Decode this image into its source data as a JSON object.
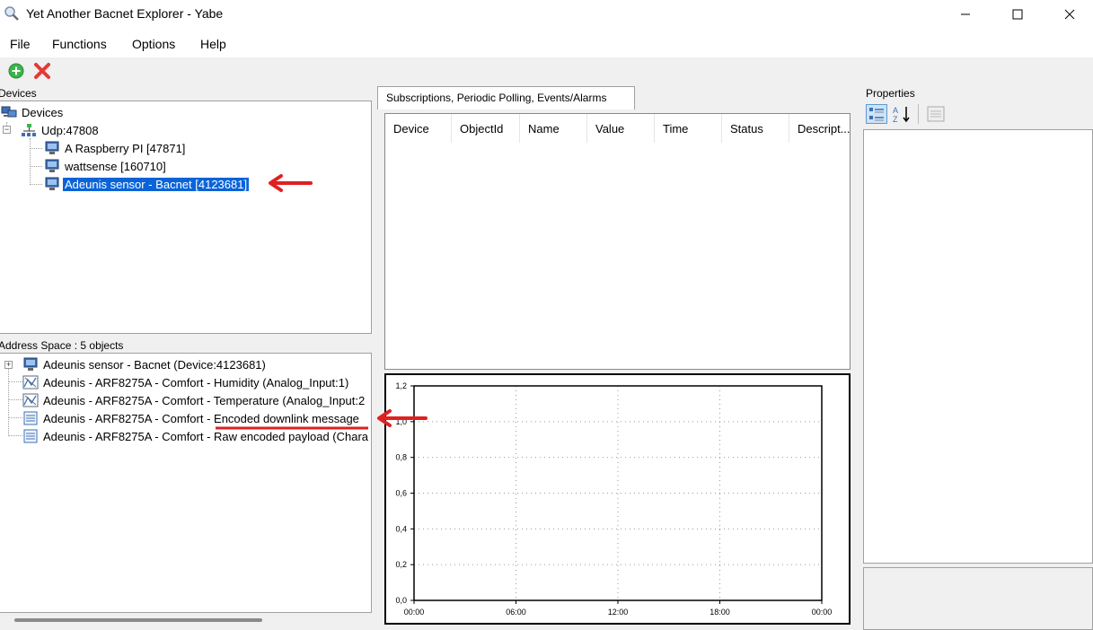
{
  "window": {
    "title": "Yet Another Bacnet Explorer - Yabe"
  },
  "menu": [
    "File",
    "Functions",
    "Options",
    "Help"
  ],
  "devices_panel": {
    "label": "Devices",
    "root": "Devices",
    "network": "Udp:47808",
    "items": [
      "A Raspberry PI [47871]",
      "wattsense [160710]",
      "Adeunis sensor - Bacnet [4123681]"
    ],
    "selected_index": 2
  },
  "address_space": {
    "label": "Address Space : 5 objects",
    "items": [
      "Adeunis sensor - Bacnet (Device:4123681)",
      "Adeunis - ARF8275A - Comfort - Humidity (Analog_Input:1)",
      "Adeunis - ARF8275A - Comfort - Temperature (Analog_Input:2",
      "Adeunis - ARF8275A - Comfort - Encoded downlink message",
      "Adeunis - ARF8275A - Comfort - Raw encoded payload (Chara"
    ]
  },
  "subscriptions": {
    "tab": "Subscriptions, Periodic Polling, Events/Alarms",
    "columns": [
      "Device",
      "ObjectId",
      "Name",
      "Value",
      "Time",
      "Status",
      "Descript..."
    ]
  },
  "chart": {
    "y_ticks": [
      "1,2",
      "1,0",
      "0,8",
      "0,6",
      "0,4",
      "0,2",
      "0,0"
    ],
    "x_ticks": [
      "00:00",
      "06:00",
      "12:00",
      "18:00",
      "00:00"
    ]
  },
  "properties": {
    "label": "Properties"
  },
  "colors": {
    "selection": "#0a64d8",
    "annotation": "#e02020",
    "add_green": "#3bb54a",
    "delete_red": "#e53935"
  }
}
